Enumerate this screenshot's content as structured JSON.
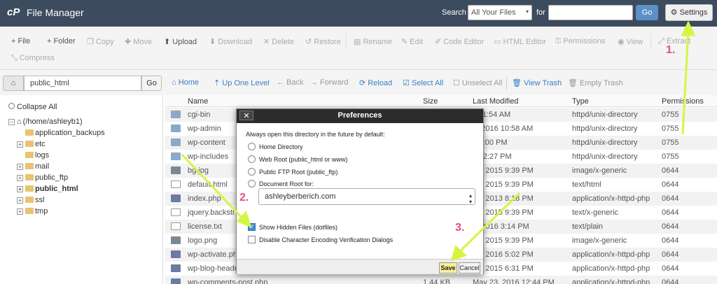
{
  "header": {
    "logo": "cP",
    "title": "File Manager",
    "search_label": "Search",
    "search_scope": "All Your Files",
    "for_label": "for",
    "search_value": "",
    "go_label": "Go",
    "settings_label": "⚙ Settings"
  },
  "toolbar": {
    "items": [
      {
        "label": "+ File",
        "enabled": true
      },
      {
        "label": "+ Folder",
        "enabled": true
      },
      {
        "label": "❐ Copy",
        "enabled": false
      },
      {
        "label": "✚ Move",
        "enabled": false
      },
      {
        "label": "⬆ Upload",
        "enabled": true
      },
      {
        "label": "⬇ Download",
        "enabled": false
      },
      {
        "label": "✕ Delete",
        "enabled": false
      },
      {
        "label": "↺ Restore",
        "enabled": false
      },
      {
        "label": "▤ Rename",
        "enabled": false
      },
      {
        "label": "✎ Edit",
        "enabled": false
      },
      {
        "label": "✐ Code Editor",
        "enabled": false
      },
      {
        "label": "▭ HTML Editor",
        "enabled": false
      },
      {
        "label": "⚿ Permissions",
        "enabled": false
      },
      {
        "label": "◉ View",
        "enabled": false
      },
      {
        "label": "⤢ Extract",
        "enabled": false
      },
      {
        "label": "⤡ Compress",
        "enabled": false
      }
    ]
  },
  "path_bar": {
    "home_icon": "home-icon",
    "path_value": "public_html",
    "go_label": "Go"
  },
  "nav": {
    "home": "⌂ Home",
    "up_one_level": "⇡ Up One Level",
    "back": "← Back",
    "forward": "→ Forward",
    "reload": "⟳ Reload",
    "select_all": "☑ Select All",
    "unselect_all": "☐ Unselect All",
    "view_trash": "🗑 View Trash",
    "empty_trash": "🗑 Empty Trash"
  },
  "tree": {
    "collapse_all": "Collapse All",
    "root": "(/home/ashleyb1)",
    "items": [
      {
        "label": "application_backups",
        "expandable": false,
        "bold": false
      },
      {
        "label": "etc",
        "expandable": true,
        "bold": false
      },
      {
        "label": "logs",
        "expandable": false,
        "bold": false
      },
      {
        "label": "mail",
        "expandable": true,
        "bold": false
      },
      {
        "label": "public_ftp",
        "expandable": true,
        "bold": false
      },
      {
        "label": "public_html",
        "expandable": true,
        "bold": true
      },
      {
        "label": "ssl",
        "expandable": true,
        "bold": false
      },
      {
        "label": "tmp",
        "expandable": true,
        "bold": false
      }
    ]
  },
  "table": {
    "headers": [
      "Name",
      "Size",
      "Last Modified",
      "Type",
      "Permissions"
    ],
    "rows": [
      {
        "icon": "dir",
        "name": "cgi-bin",
        "size": "",
        "modified": "y 11:54 AM",
        "type": "httpd/unix-directory",
        "perms": "0755"
      },
      {
        "icon": "dir",
        "name": "wp-admin",
        "size": "",
        "modified": "7, 2016 10:58 AM",
        "type": "httpd/unix-directory",
        "perms": "0755"
      },
      {
        "icon": "dir",
        "name": "wp-content",
        "size": "",
        "modified": "y 2:00 PM",
        "type": "httpd/unix-directory",
        "perms": "0755"
      },
      {
        "icon": "dir",
        "name": "wp-includes",
        "size": "",
        "modified": "y 12:27 PM",
        "type": "httpd/unix-directory",
        "perms": "0755"
      },
      {
        "icon": "img",
        "name": "bg.jpg",
        "size": "",
        "modified": "17, 2015 9:39 PM",
        "type": "image/x-generic",
        "perms": "0644"
      },
      {
        "icon": "file",
        "name": "default.html",
        "size": "",
        "modified": "17, 2015 9:39 PM",
        "type": "text/html",
        "perms": "0644"
      },
      {
        "icon": "php",
        "name": "index.php",
        "size": "",
        "modified": "24, 2013 8:18 PM",
        "type": "application/x-httpd-php",
        "perms": "0644"
      },
      {
        "icon": "file",
        "name": "jquery.backstr",
        "size": "",
        "modified": "17, 2015 9:39 PM",
        "type": "text/x-generic",
        "perms": "0644"
      },
      {
        "icon": "file",
        "name": "license.txt",
        "size": "",
        "modified": "5, 2016 3:14 PM",
        "type": "text/plain",
        "perms": "0644"
      },
      {
        "icon": "img",
        "name": "logo.png",
        "size": "",
        "modified": "17, 2015 9:39 PM",
        "type": "image/x-generic",
        "perms": "0644"
      },
      {
        "icon": "php",
        "name": "wp-activate.php",
        "size": "",
        "modified": "24, 2016 5:02 PM",
        "type": "application/x-httpd-php",
        "perms": "0644"
      },
      {
        "icon": "php",
        "name": "wp-blog-header",
        "size": "",
        "modified": "19, 2015 6:31 PM",
        "type": "application/x-httpd-php",
        "perms": "0644"
      },
      {
        "icon": "php",
        "name": "wp-comments-post.php",
        "size": "1.44 KB",
        "modified": "May 23, 2016 12:44 PM",
        "type": "application/x-httpd-php",
        "perms": "0644"
      }
    ]
  },
  "dialog": {
    "close_label": "✕",
    "title": "Preferences",
    "intro": "Always open this directory in the future by default:",
    "options": [
      "Home Directory",
      "Web Root (public_html or www)",
      "Public FTP Root (public_ftp)",
      "Document Root for:"
    ],
    "doc_root_value": "ashleyberberich.com",
    "show_hidden": "Show Hidden Files (dotfiles)",
    "disable_encoding": "Disable Character Encoding Verification Dialogs",
    "save_label": "Save",
    "cancel_label": "Cancel"
  },
  "annotations": {
    "step1": "1.",
    "step2": "2.",
    "step3": "3.",
    "arrow_color": "#d6f542",
    "label_color": "#e24d8c"
  }
}
